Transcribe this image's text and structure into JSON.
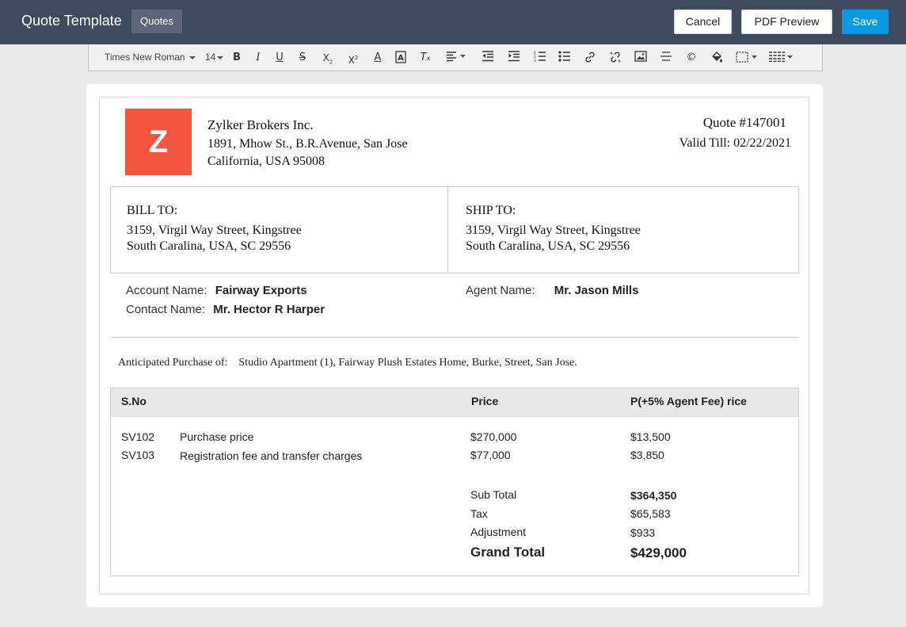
{
  "header": {
    "title": "Quote Template",
    "module_tag": "Quotes",
    "cancel_label": "Cancel",
    "preview_label": "PDF Preview",
    "save_label": "Save"
  },
  "toolbar": {
    "font_family": "Times New Roman",
    "font_size": "14"
  },
  "document": {
    "logo_letter": "Z",
    "company": {
      "name": "Zylker Brokers Inc.",
      "line1": "1891, Mhow St., B.R.Avenue, San Jose",
      "line2": "California, USA 95008"
    },
    "quote": {
      "number": "Quote #147001",
      "valid_till": "Valid Till: 02/22/2021"
    },
    "bill_to": {
      "label": "BILL TO:",
      "line1": "3159, Virgil Way Street, Kingstree",
      "line2": "South Caralina, USA, SC 29556"
    },
    "ship_to": {
      "label": "SHIP TO:",
      "line1": "3159, Virgil Way Street, Kingstree",
      "line2": "South Caralina, USA, SC 29556"
    },
    "account_label": "Account Name:",
    "account_value": "Fairway Exports",
    "contact_label": "Contact Name:",
    "contact_value": "Mr. Hector R Harper",
    "agent_label": "Agent Name:",
    "agent_value": "Mr. Jason Mills",
    "anticipated_label": "Anticipated Purchase of:",
    "anticipated_value": "Studio Apartment (1), Fairway Plush Estates Home, Burke, Street, San Jose.",
    "table": {
      "headers": [
        "S.No",
        "Price",
        "P(+5% Agent Fee) rice"
      ],
      "rows": [
        {
          "sno": "SV102",
          "desc": "Purchase price",
          "price": "$270,000",
          "fee": "$13,500"
        },
        {
          "sno": "SV103",
          "desc": "Registration fee and transfer charges",
          "price": "$77,000",
          "fee": "$3,850"
        }
      ],
      "summary": [
        {
          "label": "Sub Total",
          "value": "$364,350"
        },
        {
          "label": "Tax",
          "value": "$65,583"
        },
        {
          "label": "Adjustment",
          "value": "$933"
        },
        {
          "label": "Grand Total",
          "value": "$429,000"
        }
      ]
    }
  }
}
